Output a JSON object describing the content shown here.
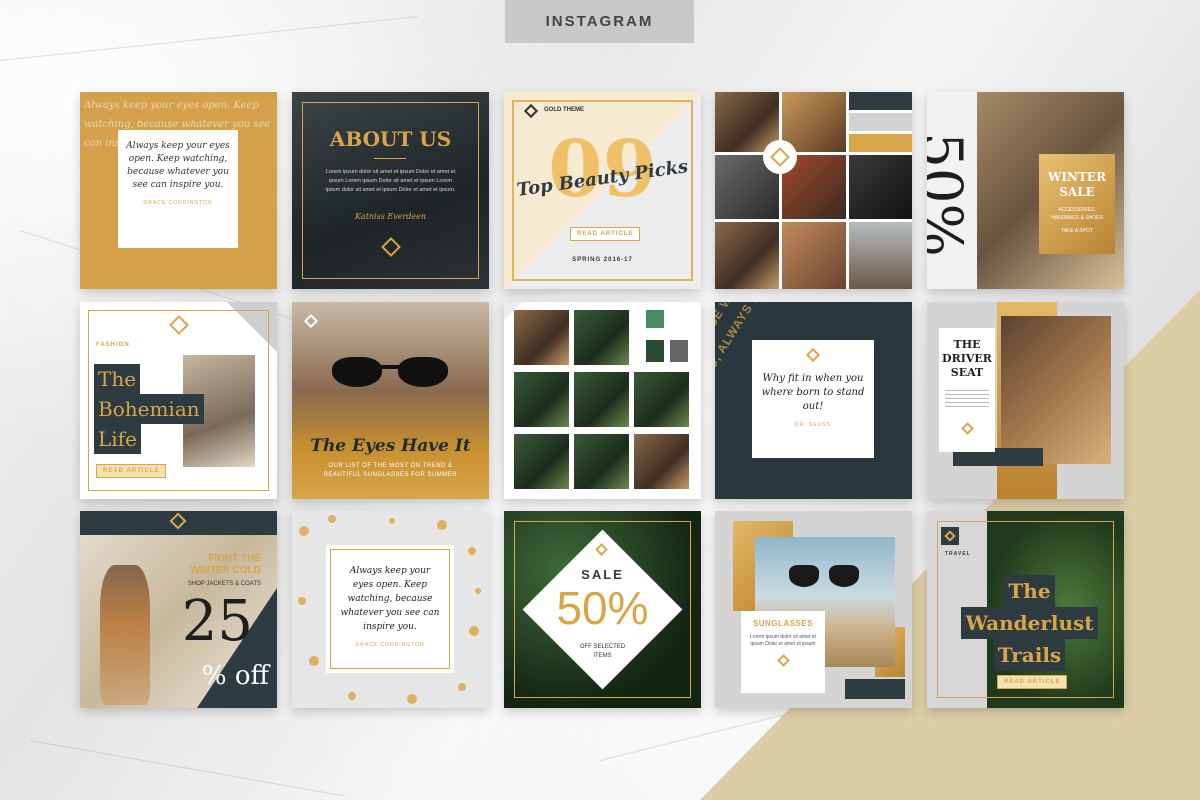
{
  "header": {
    "tab_label": "INSTAGRAM"
  },
  "colors": {
    "gold": "#d8a54a",
    "navy": "#2e3b40",
    "cream": "#f3ead6"
  },
  "tiles": {
    "t1": {
      "quote": "Always keep your eyes open. Keep watching, because whatever you see can inspire you.",
      "author": "GRACE CODDINGTON"
    },
    "t2": {
      "title": "ABOUT US",
      "body": "Lorem ipsum dolor sit amet et ipsum Dolor et amet et ipsum Lorem ipsum Dolor sit amet et ipsum Lorem ipsum dolor sit amet et ipsum Dolor et amet et ipsum.",
      "signature": "Katniss Everdeen"
    },
    "t3": {
      "brand": "GOLD THEME",
      "number": "09",
      "title": "Top Beauty Picks",
      "button": "READ ARTICLE",
      "footer": "SPRING 2016-17"
    },
    "t5": {
      "big": "50%",
      "title": "WINTER SALE",
      "sub": "ACCESSORIES, HANDBAGS & SHOES",
      "badge": "TAKE A SPOT"
    },
    "t6": {
      "category": "FASHION",
      "line1": "The",
      "line2": "Bohemian",
      "line3": "Life",
      "button": "READ ARTICLE"
    },
    "t7": {
      "title": "The Eyes Have It",
      "sub": "OUR LIST OF THE MOST ON TREND & BEAUTIFUL SUNGLASSES FOR SUMMER"
    },
    "t9": {
      "quote": "Why fit in when you where born to stand out!",
      "author": "DR. SEUSS",
      "pattern": "KEEP WATCHING, BECAUSE WHATEVER YOU SEE CAN INSPIRE YOU, ALWAYS KEEP YOUR EYES OPEN."
    },
    "t10": {
      "title": "THE DRIVER SEAT"
    },
    "t11": {
      "line1": "FIGHT THE",
      "line2": "WINTER COLD",
      "sub": "SHOP JACKETS & COATS",
      "big": "25",
      "pct": "% off"
    },
    "t12": {
      "quote": "Always keep your eyes open. Keep watching, because whatever you see can inspire you.",
      "author": "GRACE CODDINGTON"
    },
    "t13": {
      "sale": "SALE",
      "big": "50%",
      "sub": "OFF SELECTED ITEMS"
    },
    "t14": {
      "title": "SUNGLASSES",
      "body": "Lorem ipsum dolor sit amet et ipsum Dolor et amet et ipsum"
    },
    "t15": {
      "category": "TRAVEL",
      "line1": "The",
      "line2": "Wanderlust",
      "line3": "Trails",
      "button": "READ ARTICLE"
    }
  }
}
